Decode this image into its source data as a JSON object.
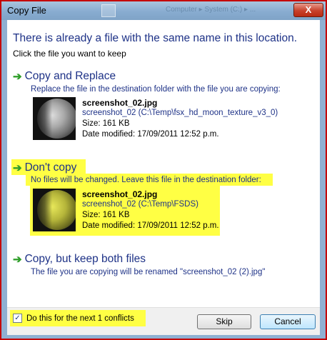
{
  "window": {
    "title": "Copy File",
    "close_label": "X",
    "background_text": "Computer ▸ System (C:) ▸ ..."
  },
  "header": {
    "title": "There is already a file with the same name in this location.",
    "subtitle": "Click the file you want to keep"
  },
  "options": {
    "copy_replace": {
      "title": "Copy and Replace",
      "description": "Replace the file in the destination folder with the file you are copying:",
      "file": {
        "name": "screenshot_02.jpg",
        "path": "screenshot_02 (C:\\Temp\\fsx_hd_moon_texture_v3_0)",
        "size": "Size: 161 KB",
        "modified": "Date modified: 17/09/2011 12:52 p.m."
      }
    },
    "dont_copy": {
      "title": "Don't copy",
      "description": "No files will be changed. Leave this file in the destination folder:",
      "file": {
        "name": "screenshot_02.jpg",
        "path": "screenshot_02 (C:\\Temp\\FSDS)",
        "size": "Size: 161 KB",
        "modified": "Date modified: 17/09/2011 12:52 p.m."
      }
    },
    "keep_both": {
      "title": "Copy, but keep both files",
      "description": "The file you are copying will be renamed \"screenshot_02 (2).jpg\""
    }
  },
  "footer": {
    "checkbox_label": "Do this for the next 1 conflicts",
    "checkbox_checked": true,
    "checkbox_mark": "✓",
    "skip_label": "Skip",
    "cancel_label": "Cancel"
  },
  "colors": {
    "link_blue": "#1e3287",
    "arrow_green": "#2f9e2a",
    "highlight": "#ffff44",
    "border_red": "#c40000"
  },
  "icons": {
    "option_arrow": "green-arrow-icon",
    "thumbnail": "moon-image-thumbnail"
  }
}
